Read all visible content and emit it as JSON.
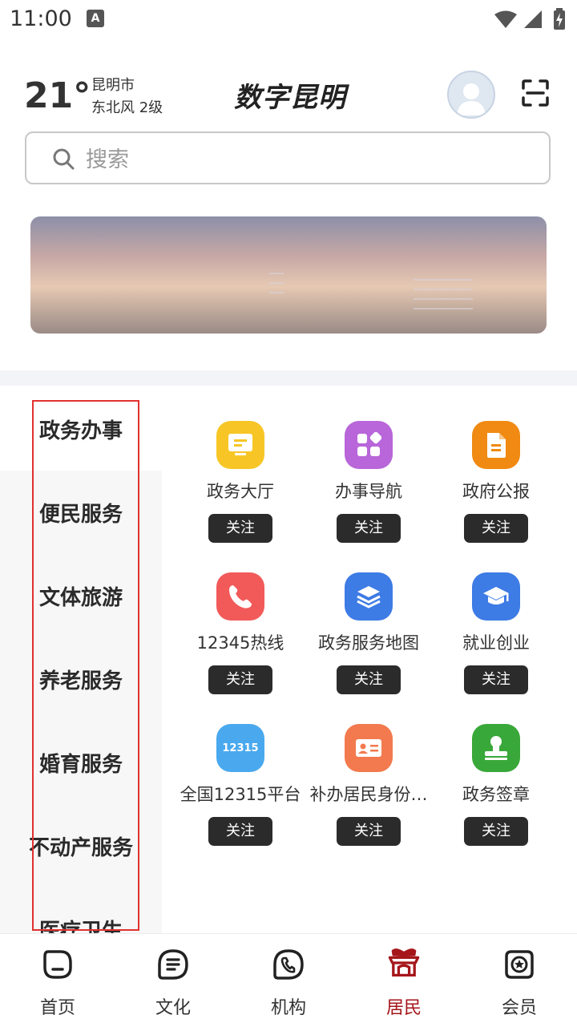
{
  "status": {
    "time": "11:00",
    "a_badge": "A"
  },
  "weather": {
    "temperature": "21°",
    "city": "昆明市",
    "wind": "东北风  2级"
  },
  "header": {
    "logo": "数字昆明"
  },
  "search": {
    "placeholder": "搜索"
  },
  "sidebar": {
    "items": [
      {
        "label": "政务办事"
      },
      {
        "label": "便民服务"
      },
      {
        "label": "文体旅游"
      },
      {
        "label": "养老服务"
      },
      {
        "label": "婚育服务"
      },
      {
        "label": "不动产服务"
      },
      {
        "label": "医疗卫生"
      }
    ],
    "active_index": 0
  },
  "grid": {
    "follow_label": "关注",
    "items": [
      {
        "label": "政务大厅",
        "icon": "screen-icon",
        "color": "#f7c626"
      },
      {
        "label": "办事导航",
        "icon": "apps-icon",
        "color": "#b866d9"
      },
      {
        "label": "政府公报",
        "icon": "document-icon",
        "color": "#f08a12"
      },
      {
        "label": "12345热线",
        "icon": "phone-icon",
        "color": "#f25a5a"
      },
      {
        "label": "政务服务地图",
        "icon": "layers-icon",
        "color": "#3d7be5"
      },
      {
        "label": "就业创业",
        "icon": "graduation-cap-icon",
        "color": "#3d7be5"
      },
      {
        "label": "全国12315平台",
        "icon": "badge-12315-icon",
        "color": "#4aa9ee",
        "badge": "12315"
      },
      {
        "label": "补办居民身份…",
        "icon": "id-card-icon",
        "color": "#f27a4e"
      },
      {
        "label": "政务签章",
        "icon": "stamp-icon",
        "color": "#39a83a"
      }
    ]
  },
  "nav": {
    "active_index": 3,
    "accent": "#a5161b",
    "items": [
      {
        "label": "首页",
        "icon": "home-icon"
      },
      {
        "label": "文化",
        "icon": "culture-icon"
      },
      {
        "label": "机构",
        "icon": "institution-icon"
      },
      {
        "label": "居民",
        "icon": "resident-icon"
      },
      {
        "label": "会员",
        "icon": "member-icon"
      }
    ]
  }
}
